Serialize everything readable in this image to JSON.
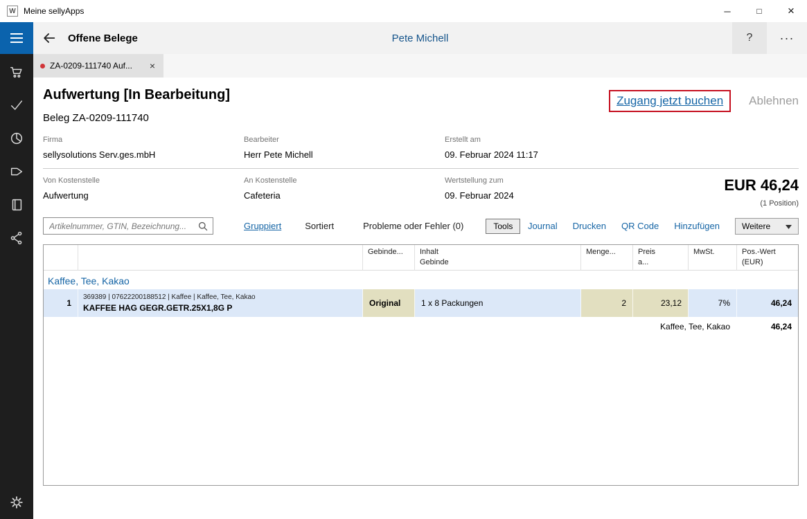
{
  "colors": {
    "accent_blue": "#0b63ad",
    "link_blue": "#1464a5",
    "highlight_row": "#dce8f8",
    "editable_cell": "#e2dfc0",
    "alert_red": "#c50f1f",
    "sidebar_bg": "#1e1e1e"
  },
  "window": {
    "title": "Meine sellyApps",
    "icon_letter": "W",
    "minimize": "─",
    "maximize": "□",
    "close": "×"
  },
  "header": {
    "title": "Offene Belege",
    "user": "Pete Michell",
    "help": "?",
    "more": "···"
  },
  "tab": {
    "label": "ZA-0209-111740 Auf...",
    "close": "×"
  },
  "doc": {
    "title": "Aufwertung [In Bearbeitung]",
    "beleg": "Beleg ZA-0209-111740",
    "book_action": "Zugang jetzt buchen",
    "reject_action": "Ablehnen",
    "fields": [
      {
        "label": "Firma",
        "value": "sellysolutions Serv.ges.mbH"
      },
      {
        "label": "Bearbeiter",
        "value": "Herr Pete Michell"
      },
      {
        "label": "Erstellt am",
        "value": "09. Februar 2024 11:17"
      },
      {
        "label": "Von Kostenstelle",
        "value": "Aufwertung"
      },
      {
        "label": "An Kostenstelle",
        "value": "Cafeteria"
      },
      {
        "label": "Wertstellung zum",
        "value": "09. Februar 2024"
      }
    ],
    "total_amount": "EUR 46,24",
    "total_positions": "(1 Position)"
  },
  "toolbar": {
    "search_placeholder": "Artikelnummer, GTIN, Bezeichnung...",
    "grouped": "Gruppiert",
    "sorted": "Sortiert",
    "problems": "Probleme oder Fehler (0)",
    "tools": "Tools",
    "journal": "Journal",
    "print": "Drucken",
    "qr_code": "QR Code",
    "add": "Hinzufügen",
    "more": "Weitere"
  },
  "table": {
    "headers": [
      {
        "l1": "",
        "l2": ""
      },
      {
        "l1": "",
        "l2": ""
      },
      {
        "l1": "Gebinde...",
        "l2": ""
      },
      {
        "l1": "Inhalt",
        "l2": "Gebinde"
      },
      {
        "l1": "Menge...",
        "l2": ""
      },
      {
        "l1": "Preis",
        "l2": "a..."
      },
      {
        "l1": "MwSt.",
        "l2": ""
      },
      {
        "l1": "Pos.-Wert",
        "l2": "(EUR)"
      }
    ],
    "group_label": "Kaffee, Tee, Kakao",
    "rows": [
      {
        "pos": "1",
        "meta": "369389 | 07622200188512 | Kaffee | Kaffee, Tee, Kakao",
        "name": "KAFFEE HAG GEGR.GETR.25X1,8G P",
        "gebinde": "Original",
        "inhalt": "1 x 8 Packungen",
        "menge": "2",
        "preis": "23,12",
        "mwst": "7%",
        "wert": "46,24"
      }
    ],
    "summary": {
      "group": "Kaffee, Tee, Kakao",
      "value": "46,24"
    }
  },
  "sidebar": {
    "icons": [
      "menu",
      "cart",
      "check",
      "pie-chart",
      "tag",
      "journal",
      "share",
      "settings"
    ]
  }
}
